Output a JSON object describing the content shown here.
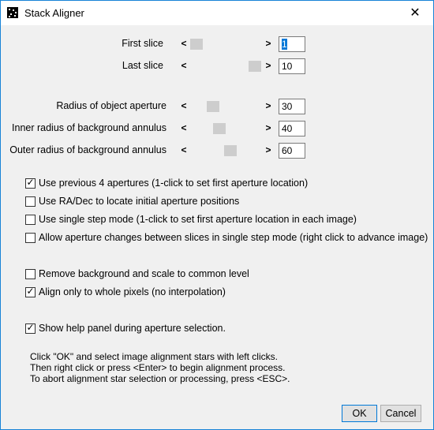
{
  "window": {
    "title": "Stack Aligner",
    "close_glyph": "✕"
  },
  "sliders": [
    {
      "label": "First slice",
      "value": "1",
      "selected": true,
      "position": 0.05
    },
    {
      "label": "Last slice",
      "value": "10",
      "selected": false,
      "position": 1.0
    },
    {
      "label": "Radius of object aperture",
      "value": "30",
      "selected": false,
      "position": 0.3
    },
    {
      "label": "Inner radius of background annulus",
      "value": "40",
      "selected": false,
      "position": 0.4
    },
    {
      "label": "Outer radius of background annulus",
      "value": "60",
      "selected": false,
      "position": 0.6
    }
  ],
  "arrows": {
    "left": "<",
    "right": ">"
  },
  "checkboxes": [
    {
      "label": "Use previous 4 apertures (1-click to set first aperture location)",
      "checked": true
    },
    {
      "label": "Use RA/Dec to locate initial aperture positions",
      "checked": false
    },
    {
      "label": "Use single step mode (1-click to set first aperture location in each image)",
      "checked": false
    },
    {
      "label": "Allow aperture changes between slices in single step mode (right click to advance image)",
      "checked": false
    },
    {
      "label": "Remove background and scale to common level",
      "checked": false
    },
    {
      "label": "Align only to whole pixels (no interpolation)",
      "checked": true
    },
    {
      "label": "Show help panel during aperture selection.",
      "checked": true
    }
  ],
  "help_text": [
    "Click \"OK\" and select image alignment stars with left clicks.",
    "Then right click or press <Enter> to begin alignment process.",
    "To abort alignment star selection or processing, press <ESC>."
  ],
  "buttons": {
    "ok": "OK",
    "cancel": "Cancel"
  },
  "check_glyph": "✓"
}
